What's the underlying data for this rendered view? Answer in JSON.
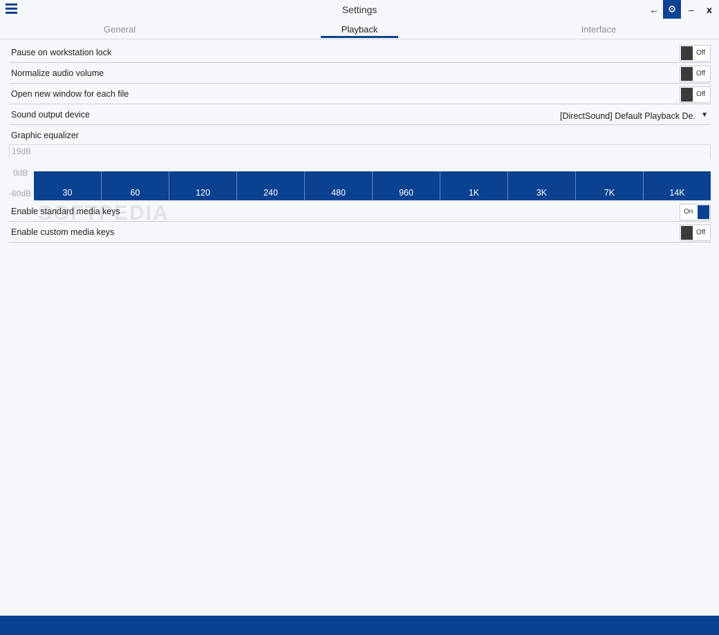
{
  "window": {
    "title": "Settings",
    "icons": {
      "menu": "hamburger-menu-icon",
      "back": "arrow-left-icon",
      "settings": "gear-icon",
      "minimize": "minimize-icon",
      "close": "close-icon"
    },
    "back_glyph": "←",
    "settings_glyph": "⚙",
    "minimize_glyph": "–",
    "close_glyph": "x"
  },
  "tabs": [
    {
      "label": "General",
      "active": false
    },
    {
      "label": "Playback",
      "active": true
    },
    {
      "label": "Interface",
      "active": false
    }
  ],
  "settings": [
    {
      "label": "Pause on workstation lock",
      "state": "Off"
    },
    {
      "label": "Normalize audio volume",
      "state": "Off"
    },
    {
      "label": "Open new window for each file",
      "state": "Off"
    },
    {
      "label": "Sound output device",
      "value": "[DirectSound]  Default  Playback De...",
      "arrow": "▼"
    },
    {
      "label": "Graphic equalizer"
    }
  ],
  "equalizer": {
    "db_labels": {
      "top": "19dB",
      "mid": "0dB",
      "bottom": "-60dB"
    },
    "bands": [
      "30",
      "60",
      "120",
      "240",
      "480",
      "960",
      "1K",
      "3K",
      "7K",
      "14K"
    ]
  },
  "media_keys": [
    {
      "label": "Enable standard media keys",
      "state": "On"
    },
    {
      "label": "Enable custom media keys",
      "state": "Off"
    }
  ],
  "watermark": "SOFTPEDIA",
  "colors": {
    "accent": "#0a4190",
    "background": "#f6f7fb",
    "toggle_off_knob": "#3b3b3b"
  }
}
